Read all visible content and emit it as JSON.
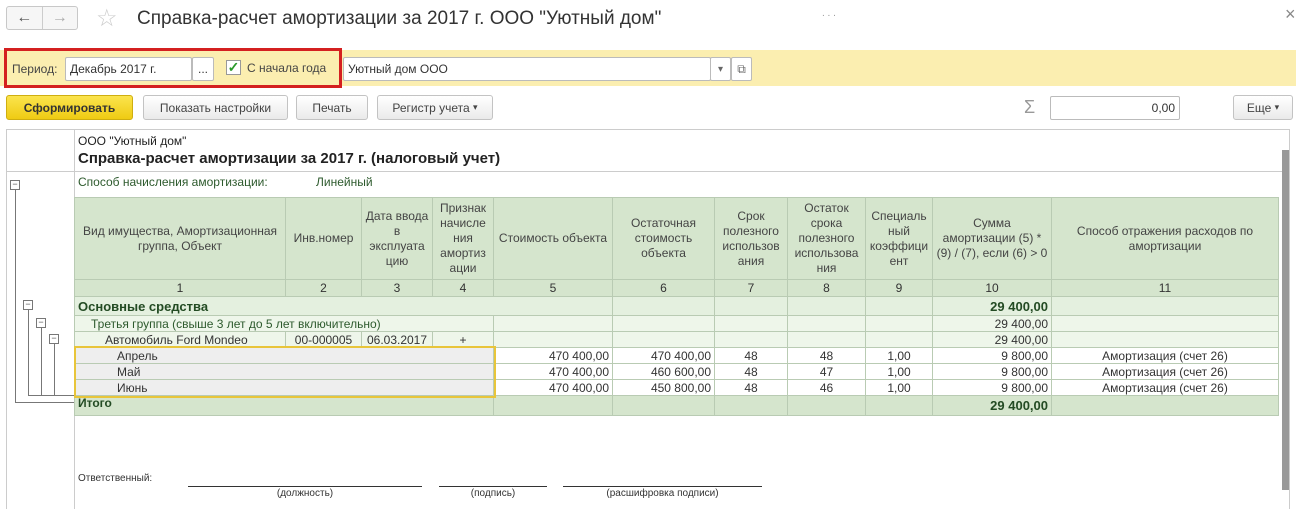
{
  "window": {
    "title": "Справка-расчет амортизации за 2017 г. ООО \"Уютный дом\"",
    "more": ". . .",
    "close": "×"
  },
  "icons": {
    "back": "←",
    "forward": "→",
    "star": "☆",
    "check": "✓",
    "sum": "Σ",
    "dropdown": "▾",
    "open": "⧉",
    "minus": "−"
  },
  "filters": {
    "period_label": "Период:",
    "period_value": "Декабрь 2017 г.",
    "period_select": "...",
    "from_year_start_label": "С начала года",
    "from_year_start_checked": true,
    "organization": "Уютный дом ООО"
  },
  "toolbar": {
    "generate": "Сформировать",
    "show_settings": "Показать настройки",
    "print": "Печать",
    "register": "Регистр учета",
    "sum_value": "0,00",
    "more": "Еще"
  },
  "report": {
    "org": "ООО \"Уютный дом\"",
    "title": "Справка-расчет амортизации за 2017 г. (налоговый учет)",
    "method_label": "Способ начисления амортизации:",
    "method_value": "Линейный",
    "columns": [
      "Вид имущества, Амортизационная группа, Объект",
      "Инв.номер",
      "Дата ввода в эксплуата цию",
      "Признак начисле ния амортиз ации",
      "Стоимость объекта",
      "Остаточная стоимость объекта",
      "Срок полезного использов ания",
      "Остаток срока полезного использова ния",
      "Специаль ный коэффици ент",
      "Сумма амортизации (5) * (9) / (7), если (6) > 0",
      "Способ отражения расходов по амортизации"
    ],
    "column_numbers": [
      "1",
      "2",
      "3",
      "4",
      "5",
      "6",
      "7",
      "8",
      "9",
      "10",
      "11"
    ],
    "section": {
      "name": "Основные средства",
      "sum": "29 400,00"
    },
    "group": {
      "name": "Третья группа (свыше 3 лет до 5 лет включительно)",
      "sum": "29 400,00"
    },
    "object": {
      "name": "Автомобиль Ford Mondeo",
      "inv": "00-000005",
      "date": "06.03.2017",
      "flag": "+",
      "sum": "29 400,00"
    },
    "months": [
      {
        "name": "Апрель",
        "cost": "470 400,00",
        "residual": "470 400,00",
        "term": "48",
        "remaining": "48",
        "coef": "1,00",
        "amount": "9 800,00",
        "method": "Амортизация (счет 26)"
      },
      {
        "name": "Май",
        "cost": "470 400,00",
        "residual": "460 600,00",
        "term": "48",
        "remaining": "47",
        "coef": "1,00",
        "amount": "9 800,00",
        "method": "Амортизация (счет 26)"
      },
      {
        "name": "Июнь",
        "cost": "470 400,00",
        "residual": "450 800,00",
        "term": "48",
        "remaining": "46",
        "coef": "1,00",
        "amount": "9 800,00",
        "method": "Амортизация (счет 26)"
      }
    ],
    "total": {
      "label": "Итого",
      "sum": "29 400,00"
    },
    "responsible_label": "Ответственный:",
    "sign": {
      "position": "(должность)",
      "signature": "(подпись)",
      "decoding": "(расшифровка подписи)"
    }
  }
}
